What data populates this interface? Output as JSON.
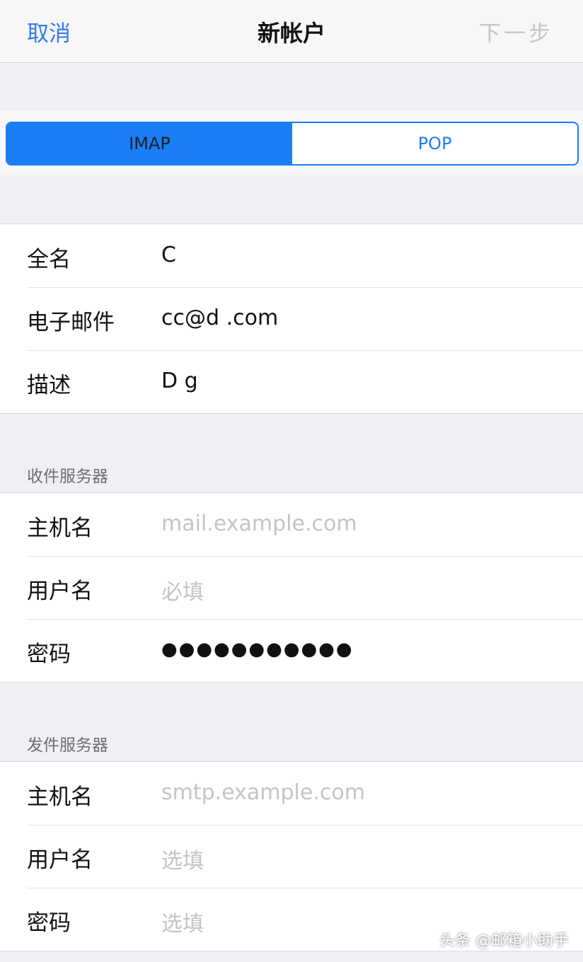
{
  "nav": {
    "cancel": "取消",
    "title": "新帐户",
    "next": "下一步"
  },
  "segment": {
    "options": [
      "IMAP",
      "POP"
    ],
    "selected": "IMAP"
  },
  "account": {
    "rows": [
      {
        "label": "全名",
        "value": "C"
      },
      {
        "label": "电子邮件",
        "value": "cc@d .com"
      },
      {
        "label": "描述",
        "value": "D g"
      }
    ]
  },
  "incoming": {
    "header": "收件服务器",
    "rows": [
      {
        "label": "主机名",
        "placeholder": "mail.example.com"
      },
      {
        "label": "用户名",
        "placeholder": "必填"
      },
      {
        "label": "密码",
        "value": "●●●●●●●●●●●"
      }
    ]
  },
  "outgoing": {
    "header": "发件服务器",
    "rows": [
      {
        "label": "主机名",
        "placeholder": "smtp.example.com"
      },
      {
        "label": "用户名",
        "placeholder": "选填"
      },
      {
        "label": "密码",
        "placeholder": "选填"
      }
    ]
  },
  "watermark": "头条 @邮箱小助手",
  "colors": {
    "accent": "#1a7ef7",
    "background": "#efeff4",
    "placeholder": "#c4c4c8"
  }
}
